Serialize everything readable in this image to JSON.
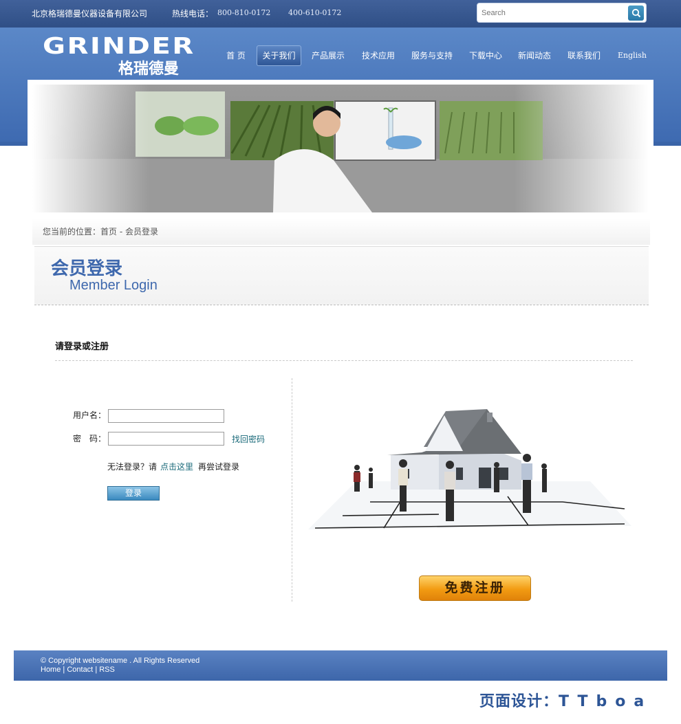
{
  "top": {
    "company": "北京格瑞德曼仪器设备有限公司",
    "hotline_label": "热线电话：",
    "phone1": "800-810-0172",
    "phone2": "400-610-0172",
    "search_placeholder": "Search"
  },
  "logo": {
    "en": "GRINDER",
    "cn": "格瑞德曼"
  },
  "nav": [
    {
      "label": "首 页"
    },
    {
      "label": "关于我们",
      "active": true
    },
    {
      "label": "产品展示"
    },
    {
      "label": "技术应用"
    },
    {
      "label": "服务与支持"
    },
    {
      "label": "下载中心"
    },
    {
      "label": "新闻动态"
    },
    {
      "label": "联系我们"
    },
    {
      "label": "English"
    }
  ],
  "breadcrumb": "您当前的位置：首页 - 会员登录",
  "title": {
    "cn": "会员登录",
    "en": "Member Login"
  },
  "login": {
    "heading": "请登录或注册",
    "username_label": "用户名：",
    "password_label": "密　码：",
    "forgot_link": "找回密码",
    "help_prefix": "无法登录？请",
    "help_link": "点击这里",
    "help_suffix": "再尝试登录",
    "submit_label": "登录",
    "register_label": "免费注册"
  },
  "footer": {
    "copyright": "© Copyright websitename . All Rights Reserved",
    "links": [
      "Home",
      "Contact",
      "RSS"
    ],
    "credit": "页面设计：",
    "credit_name": "TTboa"
  },
  "colors": {
    "primary": "#3d69b0",
    "accent": "#f29b12",
    "link": "#1a6a7a"
  }
}
